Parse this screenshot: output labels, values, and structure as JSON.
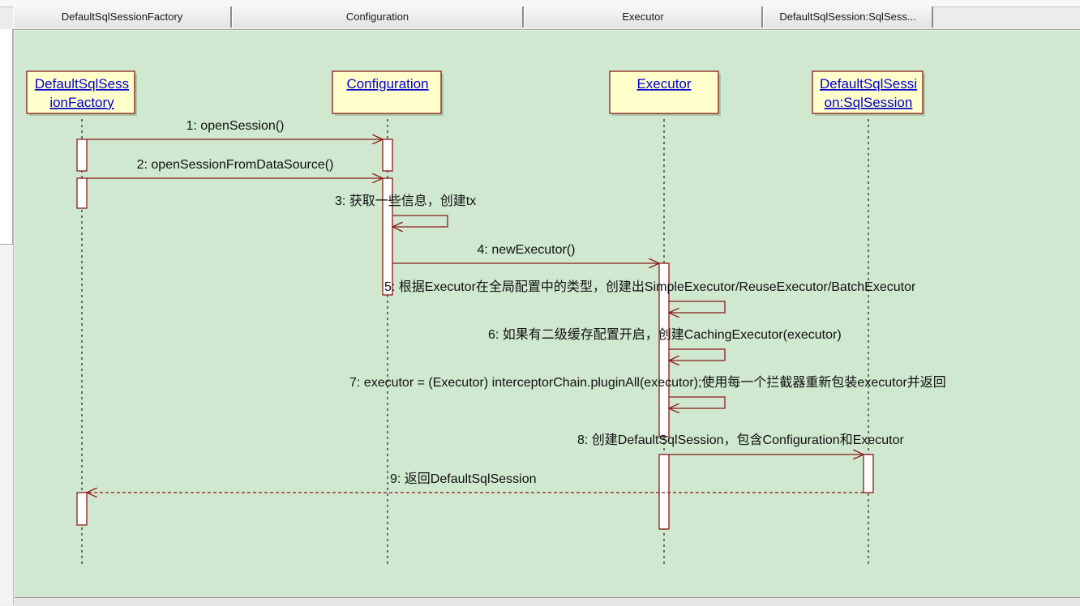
{
  "column_headers": [
    "DefaultSqlSessionFactory",
    "Configuration",
    "Executor",
    "DefaultSqlSession:SqlSess..."
  ],
  "participants": [
    {
      "id": "factory",
      "lines": [
        "DefaultSqlSess",
        "ionFactory"
      ]
    },
    {
      "id": "configuration",
      "lines": [
        "Configuration"
      ]
    },
    {
      "id": "executor",
      "lines": [
        "Executor"
      ]
    },
    {
      "id": "sqlsession",
      "lines": [
        "DefaultSqlSessi",
        "on:SqlSession"
      ]
    }
  ],
  "messages": [
    {
      "id": "m1",
      "text": "1: openSession()",
      "from": "factory",
      "to": "configuration",
      "kind": "call"
    },
    {
      "id": "m2",
      "text": "2: openSessionFromDataSource()",
      "from": "factory",
      "to": "configuration",
      "kind": "call"
    },
    {
      "id": "m3",
      "text": "3: 获取一些信息，创建tx",
      "from": "configuration",
      "to": "configuration",
      "kind": "self"
    },
    {
      "id": "m4",
      "text": "4: newExecutor()",
      "from": "configuration",
      "to": "executor",
      "kind": "call"
    },
    {
      "id": "m5",
      "text": "5: 根据Executor在全局配置中的类型，创建出SimpleExecutor/ReuseExecutor/BatchExecutor",
      "from": "executor",
      "to": "executor",
      "kind": "self"
    },
    {
      "id": "m6",
      "text": "6: 如果有二级缓存配置开启，创建CachingExecutor(executor)",
      "from": "executor",
      "to": "executor",
      "kind": "self"
    },
    {
      "id": "m7",
      "text": "7: executor = (Executor) interceptorChain.pluginAll(executor);使用每一个拦截器重新包装executor并返回",
      "from": "executor",
      "to": "executor",
      "kind": "self"
    },
    {
      "id": "m8",
      "text": "8: 创建DefaultSqlSession，包含Configuration和Executor",
      "from": "executor",
      "to": "sqlsession",
      "kind": "call"
    },
    {
      "id": "m9",
      "text": "9: 返回DefaultSqlSession",
      "from": "sqlsession",
      "to": "factory",
      "kind": "return"
    }
  ],
  "colors": {
    "canvas": "#cfe8cf",
    "participant_fill": "#ffffcc",
    "participant_border": "#8b1a1a",
    "participant_text": "#0000cc",
    "message_line": "#8b1a1a",
    "activation_fill": "#ffffff",
    "text": "#111111"
  }
}
